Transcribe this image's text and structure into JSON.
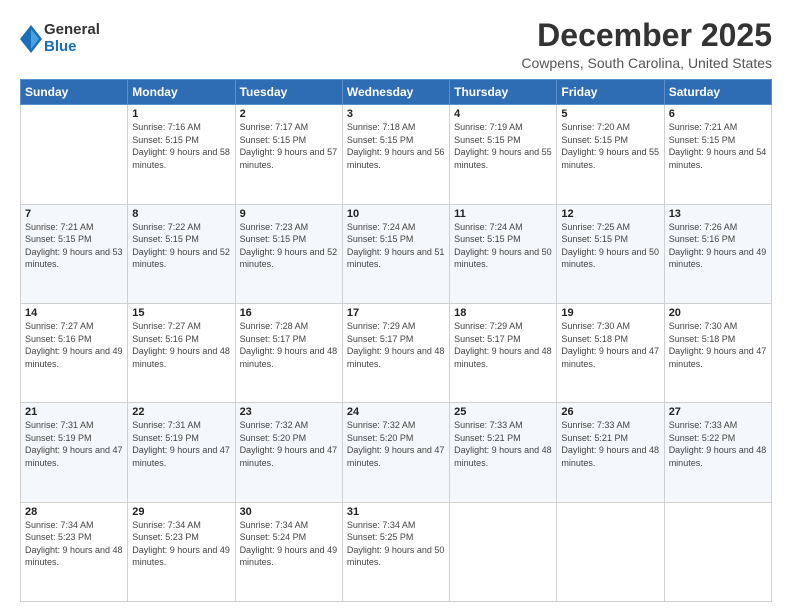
{
  "logo": {
    "general": "General",
    "blue": "Blue"
  },
  "title": "December 2025",
  "location": "Cowpens, South Carolina, United States",
  "days_header": [
    "Sunday",
    "Monday",
    "Tuesday",
    "Wednesday",
    "Thursday",
    "Friday",
    "Saturday"
  ],
  "weeks": [
    [
      {
        "day": "",
        "sunrise": "",
        "sunset": "",
        "daylight": ""
      },
      {
        "day": "1",
        "sunrise": "Sunrise: 7:16 AM",
        "sunset": "Sunset: 5:15 PM",
        "daylight": "Daylight: 9 hours and 58 minutes."
      },
      {
        "day": "2",
        "sunrise": "Sunrise: 7:17 AM",
        "sunset": "Sunset: 5:15 PM",
        "daylight": "Daylight: 9 hours and 57 minutes."
      },
      {
        "day": "3",
        "sunrise": "Sunrise: 7:18 AM",
        "sunset": "Sunset: 5:15 PM",
        "daylight": "Daylight: 9 hours and 56 minutes."
      },
      {
        "day": "4",
        "sunrise": "Sunrise: 7:19 AM",
        "sunset": "Sunset: 5:15 PM",
        "daylight": "Daylight: 9 hours and 55 minutes."
      },
      {
        "day": "5",
        "sunrise": "Sunrise: 7:20 AM",
        "sunset": "Sunset: 5:15 PM",
        "daylight": "Daylight: 9 hours and 55 minutes."
      },
      {
        "day": "6",
        "sunrise": "Sunrise: 7:21 AM",
        "sunset": "Sunset: 5:15 PM",
        "daylight": "Daylight: 9 hours and 54 minutes."
      }
    ],
    [
      {
        "day": "7",
        "sunrise": "Sunrise: 7:21 AM",
        "sunset": "Sunset: 5:15 PM",
        "daylight": "Daylight: 9 hours and 53 minutes."
      },
      {
        "day": "8",
        "sunrise": "Sunrise: 7:22 AM",
        "sunset": "Sunset: 5:15 PM",
        "daylight": "Daylight: 9 hours and 52 minutes."
      },
      {
        "day": "9",
        "sunrise": "Sunrise: 7:23 AM",
        "sunset": "Sunset: 5:15 PM",
        "daylight": "Daylight: 9 hours and 52 minutes."
      },
      {
        "day": "10",
        "sunrise": "Sunrise: 7:24 AM",
        "sunset": "Sunset: 5:15 PM",
        "daylight": "Daylight: 9 hours and 51 minutes."
      },
      {
        "day": "11",
        "sunrise": "Sunrise: 7:24 AM",
        "sunset": "Sunset: 5:15 PM",
        "daylight": "Daylight: 9 hours and 50 minutes."
      },
      {
        "day": "12",
        "sunrise": "Sunrise: 7:25 AM",
        "sunset": "Sunset: 5:15 PM",
        "daylight": "Daylight: 9 hours and 50 minutes."
      },
      {
        "day": "13",
        "sunrise": "Sunrise: 7:26 AM",
        "sunset": "Sunset: 5:16 PM",
        "daylight": "Daylight: 9 hours and 49 minutes."
      }
    ],
    [
      {
        "day": "14",
        "sunrise": "Sunrise: 7:27 AM",
        "sunset": "Sunset: 5:16 PM",
        "daylight": "Daylight: 9 hours and 49 minutes."
      },
      {
        "day": "15",
        "sunrise": "Sunrise: 7:27 AM",
        "sunset": "Sunset: 5:16 PM",
        "daylight": "Daylight: 9 hours and 48 minutes."
      },
      {
        "day": "16",
        "sunrise": "Sunrise: 7:28 AM",
        "sunset": "Sunset: 5:17 PM",
        "daylight": "Daylight: 9 hours and 48 minutes."
      },
      {
        "day": "17",
        "sunrise": "Sunrise: 7:29 AM",
        "sunset": "Sunset: 5:17 PM",
        "daylight": "Daylight: 9 hours and 48 minutes."
      },
      {
        "day": "18",
        "sunrise": "Sunrise: 7:29 AM",
        "sunset": "Sunset: 5:17 PM",
        "daylight": "Daylight: 9 hours and 48 minutes."
      },
      {
        "day": "19",
        "sunrise": "Sunrise: 7:30 AM",
        "sunset": "Sunset: 5:18 PM",
        "daylight": "Daylight: 9 hours and 47 minutes."
      },
      {
        "day": "20",
        "sunrise": "Sunrise: 7:30 AM",
        "sunset": "Sunset: 5:18 PM",
        "daylight": "Daylight: 9 hours and 47 minutes."
      }
    ],
    [
      {
        "day": "21",
        "sunrise": "Sunrise: 7:31 AM",
        "sunset": "Sunset: 5:19 PM",
        "daylight": "Daylight: 9 hours and 47 minutes."
      },
      {
        "day": "22",
        "sunrise": "Sunrise: 7:31 AM",
        "sunset": "Sunset: 5:19 PM",
        "daylight": "Daylight: 9 hours and 47 minutes."
      },
      {
        "day": "23",
        "sunrise": "Sunrise: 7:32 AM",
        "sunset": "Sunset: 5:20 PM",
        "daylight": "Daylight: 9 hours and 47 minutes."
      },
      {
        "day": "24",
        "sunrise": "Sunrise: 7:32 AM",
        "sunset": "Sunset: 5:20 PM",
        "daylight": "Daylight: 9 hours and 47 minutes."
      },
      {
        "day": "25",
        "sunrise": "Sunrise: 7:33 AM",
        "sunset": "Sunset: 5:21 PM",
        "daylight": "Daylight: 9 hours and 48 minutes."
      },
      {
        "day": "26",
        "sunrise": "Sunrise: 7:33 AM",
        "sunset": "Sunset: 5:21 PM",
        "daylight": "Daylight: 9 hours and 48 minutes."
      },
      {
        "day": "27",
        "sunrise": "Sunrise: 7:33 AM",
        "sunset": "Sunset: 5:22 PM",
        "daylight": "Daylight: 9 hours and 48 minutes."
      }
    ],
    [
      {
        "day": "28",
        "sunrise": "Sunrise: 7:34 AM",
        "sunset": "Sunset: 5:23 PM",
        "daylight": "Daylight: 9 hours and 48 minutes."
      },
      {
        "day": "29",
        "sunrise": "Sunrise: 7:34 AM",
        "sunset": "Sunset: 5:23 PM",
        "daylight": "Daylight: 9 hours and 49 minutes."
      },
      {
        "day": "30",
        "sunrise": "Sunrise: 7:34 AM",
        "sunset": "Sunset: 5:24 PM",
        "daylight": "Daylight: 9 hours and 49 minutes."
      },
      {
        "day": "31",
        "sunrise": "Sunrise: 7:34 AM",
        "sunset": "Sunset: 5:25 PM",
        "daylight": "Daylight: 9 hours and 50 minutes."
      },
      {
        "day": "",
        "sunrise": "",
        "sunset": "",
        "daylight": ""
      },
      {
        "day": "",
        "sunrise": "",
        "sunset": "",
        "daylight": ""
      },
      {
        "day": "",
        "sunrise": "",
        "sunset": "",
        "daylight": ""
      }
    ]
  ]
}
